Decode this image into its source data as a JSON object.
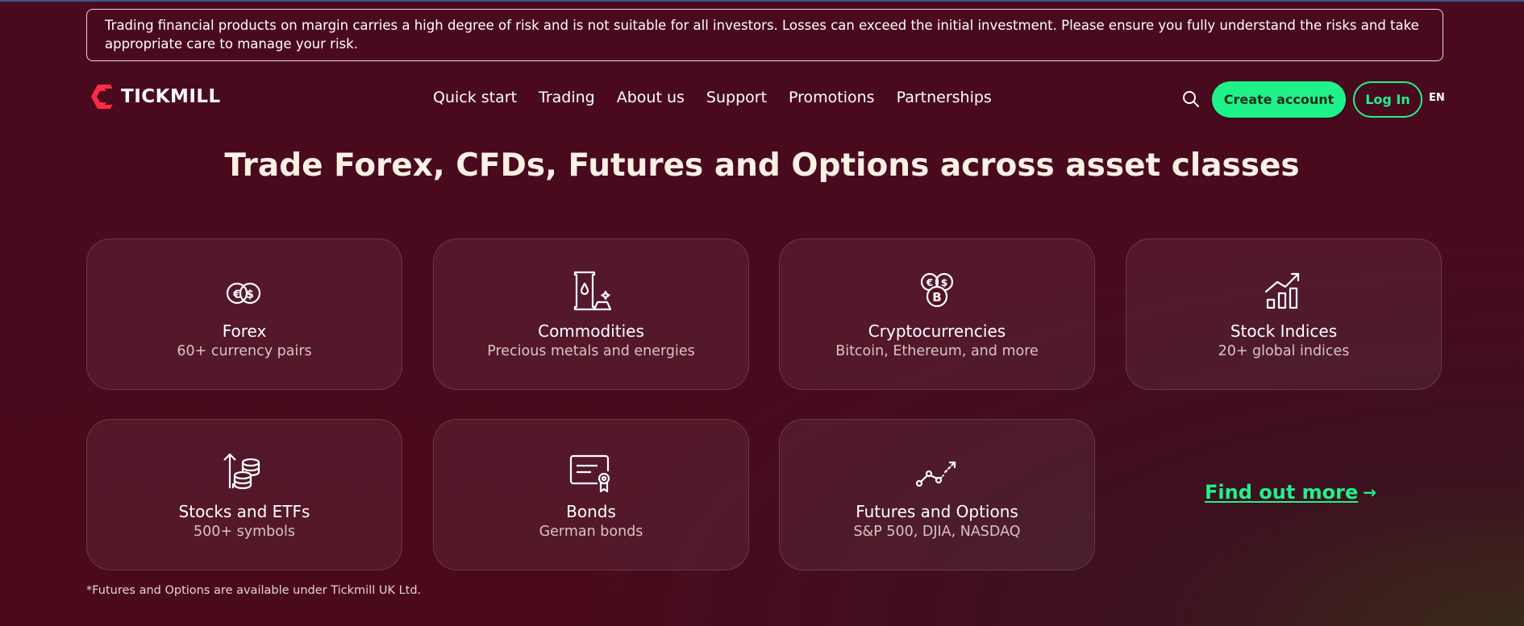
{
  "risk_warning": "Trading financial products on margin carries a high degree of risk and is not suitable for all investors. Losses can exceed the initial investment. Please ensure you fully understand the risks and take appropriate care to manage your risk.",
  "brand": {
    "name": "TICKMILL",
    "logo_color": "#ff2a4a"
  },
  "nav": [
    "Quick start",
    "Trading",
    "About us",
    "Support",
    "Promotions",
    "Partnerships"
  ],
  "header": {
    "create_account": "Create account",
    "log_in": "Log In",
    "language": "EN",
    "search_icon": "search-icon"
  },
  "headline": "Trade Forex, CFDs, Futures and Options across asset classes",
  "cards": [
    {
      "icon": "currency-coins-icon",
      "title": "Forex",
      "subtitle": "60+ currency pairs"
    },
    {
      "icon": "oil-barrel-icon",
      "title": "Commodities",
      "subtitle": "Precious metals and energies"
    },
    {
      "icon": "crypto-coins-icon",
      "title": "Cryptocurrencies",
      "subtitle": "Bitcoin, Ethereum, and more"
    },
    {
      "icon": "bar-chart-growth-icon",
      "title": "Stock Indices",
      "subtitle": "20+ global indices"
    },
    {
      "icon": "coin-stack-icon",
      "title": "Stocks and ETFs",
      "subtitle": "500+ symbols"
    },
    {
      "icon": "certificate-icon",
      "title": "Bonds",
      "subtitle": "German bonds"
    },
    {
      "icon": "trend-line-icon",
      "title": "Futures and Options",
      "subtitle": "S&P 500, DJIA, NASDAQ"
    }
  ],
  "find_more": "Find out more",
  "footnote": "*Futures and Options are available under Tickmill UK Ltd.",
  "colors": {
    "accent": "#1ff28a",
    "background": "#4a0a1e",
    "headline": "#fdf1e6"
  }
}
